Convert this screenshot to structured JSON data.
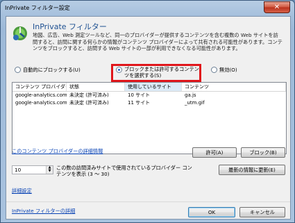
{
  "window": {
    "title": "InPrivate フィルター設定",
    "close_label": "✕"
  },
  "header": {
    "title": "InPrivate フィルター",
    "description": "地図、広告、Web 測定ツールなど、同一のプロバイダーが提供するコンテンツを含む複数の Web サイトを訪問すると、訪問に関する何らかの情報がコンテンツ プロバイダーによって共有される可能性があります。コンテンツをブロックすると、訪問する Web サイトの一部が利用できなくなる可能性があります。"
  },
  "mode": {
    "options": [
      {
        "label": "自動的にブロックする(U)",
        "selected": false
      },
      {
        "label": "ブロックまたは許可するコンテンツを選択する(S)",
        "selected": true
      },
      {
        "label": "無効(O)",
        "selected": false
      }
    ]
  },
  "table": {
    "columns": [
      "コンテンツ プロバイダー",
      "状態",
      "使用しているサイト",
      "コンテンツ"
    ],
    "rows": [
      [
        "google-analytics.com",
        "未決定 (許可済み)",
        "10 サイト",
        "ga.js"
      ],
      [
        "google-analytics.com",
        "未決定 (許可済み)",
        "11 サイト",
        "_utm.gif"
      ]
    ]
  },
  "details_link": "このコンテンツ プロバイダーの詳細情報",
  "allow_button": "許可(A)",
  "block_button": "ブロック(B)",
  "threshold": {
    "value": "10",
    "description": "この数の訪問済みサイトで使用されているプロバイダー コンテンツを表示 (3 ～ 30)"
  },
  "refresh_button": "最新の情報に更新(E)",
  "advanced_link": "詳細設定",
  "footer_link": "InPrivate フィルターの詳細",
  "ok_button": "OK",
  "cancel_button": "キャンセル",
  "colors": {
    "highlight_border": "#e0161b",
    "link": "#0a44b5",
    "title_text": "#1d4f91"
  },
  "icons": {
    "header": "inprivate-filter-icon"
  }
}
